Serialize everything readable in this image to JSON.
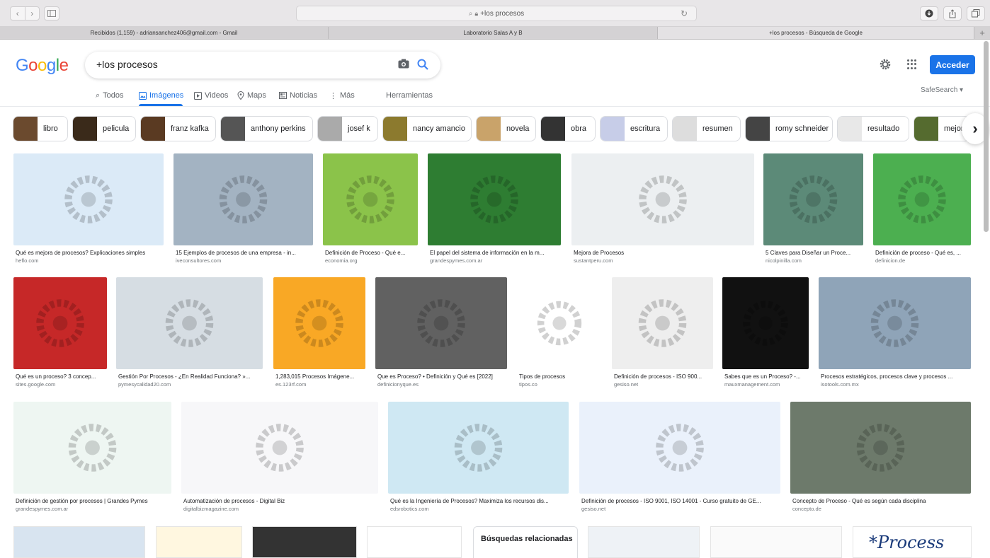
{
  "browser": {
    "address": "+los procesos",
    "tabs": [
      {
        "label": "Recibidos (1,159) - adriansanchez406@gmail.com - Gmail",
        "active": false
      },
      {
        "label": "Laboratorio Salas A y B",
        "active": false
      },
      {
        "label": "+los procesos - Búsqueda de Google",
        "active": true
      }
    ],
    "new_tab": "+"
  },
  "google": {
    "logo": [
      "G",
      "o",
      "o",
      "g",
      "l",
      "e"
    ],
    "logo_colors": [
      "#4285f4",
      "#ea4335",
      "#fbbc05",
      "#4285f4",
      "#34a853",
      "#ea4335"
    ],
    "query": "+los procesos",
    "signin": "Acceder",
    "safesearch": "SafeSearch ▾",
    "accent": "#1a73e8"
  },
  "nav": {
    "todos": "Todos",
    "imagenes": "Imágenes",
    "videos": "Videos",
    "maps": "Maps",
    "noticias": "Noticias",
    "mas": "Más",
    "herramientas": "Herramientas"
  },
  "chips": [
    "libro",
    "pelicula",
    "franz kafka",
    "anthony perkins",
    "josef k",
    "nancy amancio",
    "novela",
    "obra",
    "escritura",
    "resumen",
    "romy schneider",
    "resultado",
    "mejor"
  ],
  "chip_colors": [
    "#6b4a2e",
    "#3a2a1a",
    "#5a3a22",
    "#555",
    "#aaa",
    "#8c7a2e",
    "#c9a36a",
    "#333",
    "#c7cde8",
    "#ddd",
    "#444",
    "#e8e8e8",
    "#556b2f"
  ],
  "results": [
    {
      "title": "Qué es mejora de procesos? Explicaciones simples",
      "source": "heflo.com",
      "color": "#dbeaf7"
    },
    {
      "title": "15 Ejemplos de procesos de una empresa - in...",
      "source": "iveconsultores.com",
      "color": "#a3b3c2"
    },
    {
      "title": "Definición de Proceso - Qué e...",
      "source": "economia.org",
      "color": "#8bc34a"
    },
    {
      "title": "El papel del sistema de información en la m...",
      "source": "grandespymes.com.ar",
      "color": "#2e7d32"
    },
    {
      "title": "Mejora de Procesos",
      "source": "sustantperu.com",
      "color": "#eceff1"
    },
    {
      "title": "5 Claves para Diseñar un Proce...",
      "source": "nicolpinilla.com",
      "color": "#5c8a78"
    },
    {
      "title": "Definición de proceso - Qué es, ...",
      "source": "definicion.de",
      "color": "#4caf50"
    },
    {
      "title": "Qué es un proceso? 3 concep...",
      "source": "sites.google.com",
      "color": "#c62828"
    },
    {
      "title": "Gestión Por Procesos - ¿En Realidad Funciona? »...",
      "source": "pymesycalidad20.com",
      "color": "#d6dde3"
    },
    {
      "title": "1,283,015 Procesos Imágene...",
      "source": "es.123rf.com",
      "color": "#f9a825"
    },
    {
      "title": "Que es Proceso? • Definición y Qué es [2022]",
      "source": "definicionyque.es",
      "color": "#616161"
    },
    {
      "title": "Tipos de procesos",
      "source": "tipos.co",
      "color": "#ffffff"
    },
    {
      "title": "Definición de procesos - ISO 900...",
      "source": "gesiso.net",
      "color": "#eeeeee"
    },
    {
      "title": "Sabes que es un Proceso? -...",
      "source": "mauxmanagement.com",
      "color": "#111111"
    },
    {
      "title": "Procesos estratégicos, procesos clave y procesos ...",
      "source": "isotools.com.mx",
      "color": "#8fa4b8"
    },
    {
      "title": "Definición de gestión por procesos | Grandes Pymes",
      "source": "grandespymes.com.ar",
      "color": "#eef6f2"
    },
    {
      "title": "Automatización de procesos - Digital Biz",
      "source": "digitalbizmagazine.com",
      "color": "#f7f7f9"
    },
    {
      "title": "Qué es la Ingeniería de Procesos? Maximiza los recursos dis...",
      "source": "edsrobotics.com",
      "color": "#cfe8f3"
    },
    {
      "title": "Definición de procesos - ISO 9001, ISO 14001 - Curso gratuito de GE...",
      "source": "gesiso.net",
      "color": "#eaf1fb"
    },
    {
      "title": "Concepto de Proceso - Qué es según cada disciplina",
      "source": "concepto.de",
      "color": "#6d7a6b"
    }
  ],
  "bottom_row_colors": [
    "#d8e4f0",
    "#fff7e0",
    "#333333",
    "#ffffff",
    "#eef2f6",
    "#fafafa",
    "#ffffff"
  ],
  "related": {
    "title": "Búsquedas relacionadas"
  },
  "process_text": "*Process"
}
